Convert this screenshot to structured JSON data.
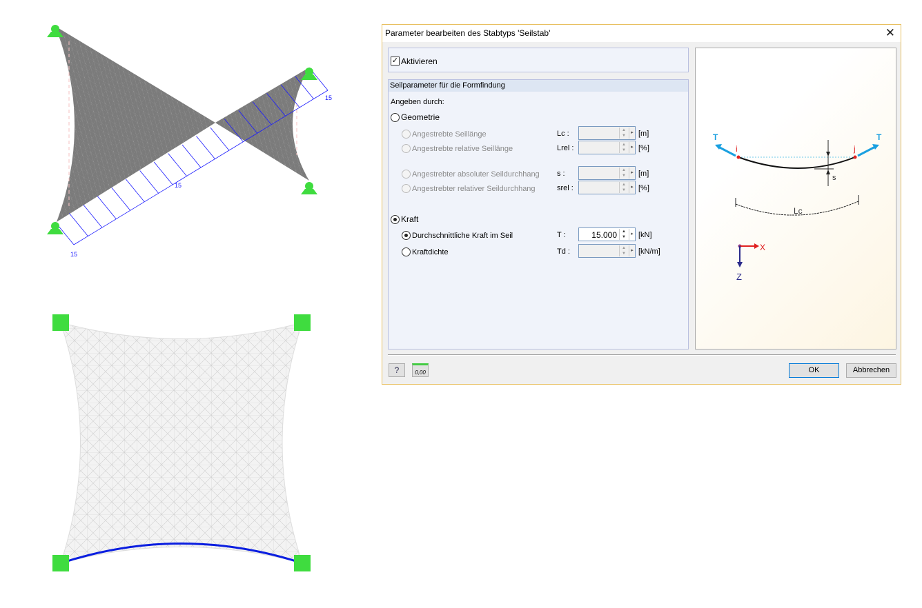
{
  "viewport_top": {
    "load_labels": [
      "15",
      "15",
      "15"
    ]
  },
  "dialog": {
    "title": "Parameter bearbeiten des Stabtyps 'Seilstab'",
    "close_icon": "close-icon",
    "activate": {
      "label": "Aktivieren",
      "checked": true
    },
    "section_title": "Seilparameter für die Formfindung",
    "specify_by": "Angeben durch:",
    "geometry": {
      "label": "Geometrie",
      "selected": false,
      "options": [
        {
          "label": "Angestrebte Seillänge",
          "symbol": "Lc :",
          "unit": "[m]",
          "value": ""
        },
        {
          "label": "Angestrebte relative Seillänge",
          "symbol": "Lrel :",
          "unit": "[%]",
          "value": ""
        },
        {
          "label": "Angestrebter absoluter Seildurchhang",
          "symbol": "s :",
          "unit": "[m]",
          "value": ""
        },
        {
          "label": "Angestrebter relativer Seildurchhang",
          "symbol": "srel :",
          "unit": "[%]",
          "value": ""
        }
      ]
    },
    "force": {
      "label": "Kraft",
      "selected": true,
      "options": [
        {
          "label": "Durchschnittliche Kraft im Seil",
          "symbol": "T :",
          "unit": "[kN]",
          "value": "15.000",
          "selected": true
        },
        {
          "label": "Kraftdichte",
          "symbol": "Td :",
          "unit": "[kN/m]",
          "value": "",
          "selected": false
        }
      ]
    },
    "diagram": {
      "T_left": "T",
      "T_right": "T",
      "node_i": "i",
      "node_j": "j",
      "sag": "s",
      "length": "Lc",
      "axis_x": "X",
      "axis_z": "Z"
    },
    "footer": {
      "help_icon": "help-icon",
      "decimals_icon": "0,00",
      "ok": "OK",
      "cancel": "Abbrechen"
    }
  },
  "colors": {
    "support": "#3fdc3f",
    "load": "#1a1aff",
    "membrane": "#7a7a7a",
    "accent_T": "#1aa0e0"
  }
}
